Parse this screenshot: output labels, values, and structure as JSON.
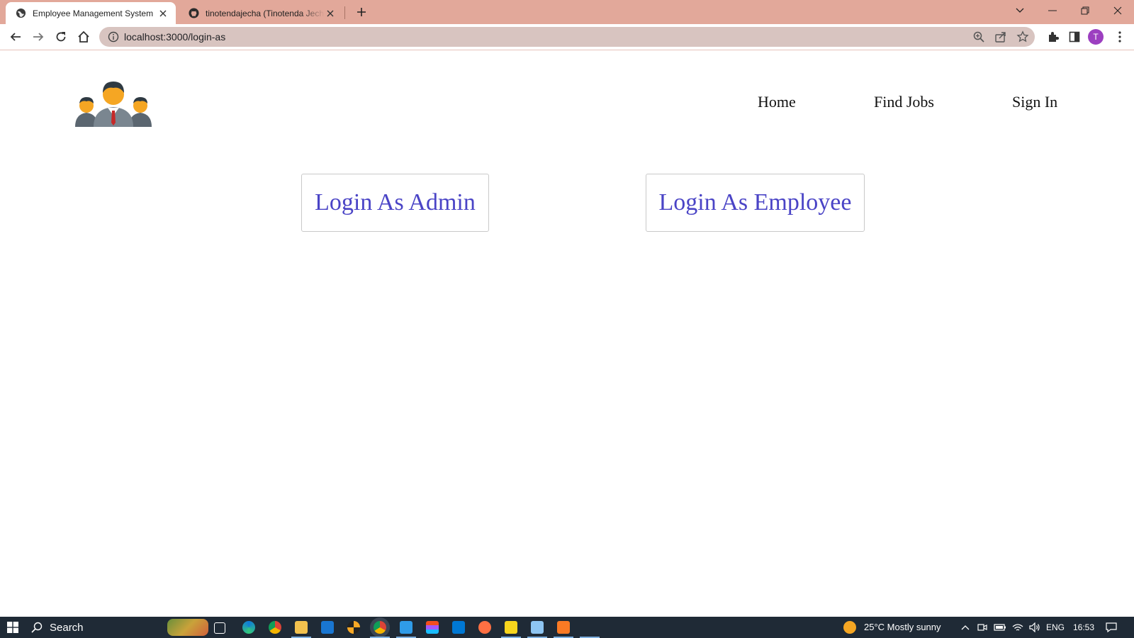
{
  "browser": {
    "tabs": [
      {
        "label": "Employee Management System",
        "active": true
      },
      {
        "label": "tinotendajecha (Tinotenda Jecha)",
        "active": false
      }
    ],
    "url": "localhost:3000/login-as"
  },
  "profile": {
    "initial": "T"
  },
  "navbar": {
    "home": "Home",
    "find_jobs": "Find Jobs",
    "sign_in": "Sign In"
  },
  "login": {
    "admin": "Login As Admin",
    "employee": "Login As Employee"
  },
  "taskbar": {
    "search": "Search",
    "weather": "25°C  Mostly sunny",
    "language": "ENG",
    "time": "16:53"
  },
  "colors": {
    "tabstrip": "#e2a89a",
    "omnibox": "#d8c4c0",
    "login_text": "#4a44c6",
    "taskbar": "#1f2a36"
  }
}
